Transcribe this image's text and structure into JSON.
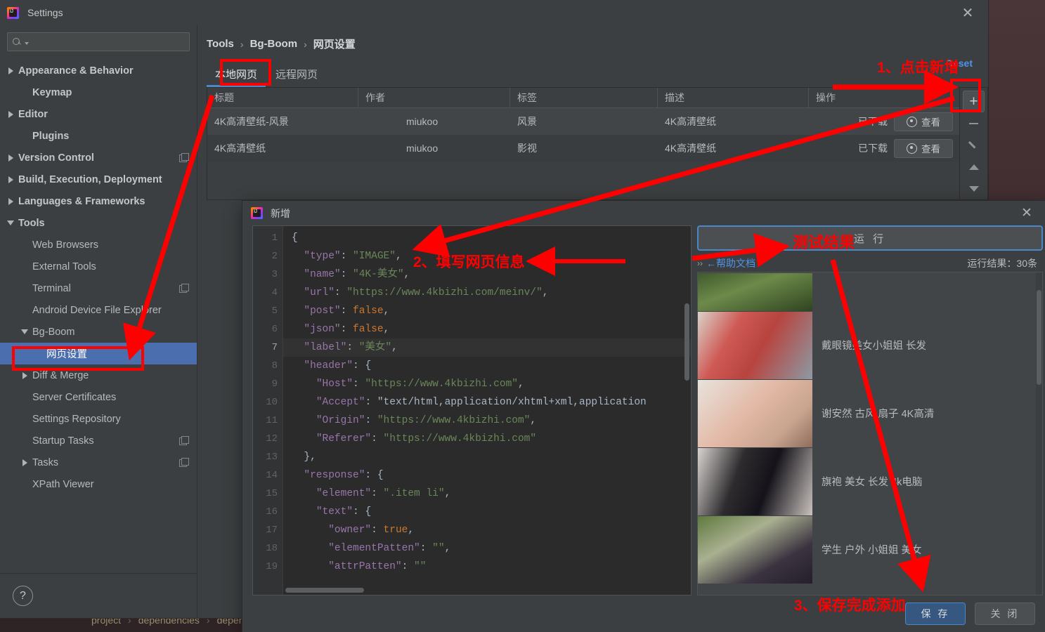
{
  "background_ide": {
    "breadcrumb": [
      "project",
      "dependencies",
      "dependency"
    ],
    "separator": "›"
  },
  "settings_window": {
    "title": "Settings",
    "title_icon": "intellij-idea-icon",
    "close_icon": "close-icon",
    "search": {
      "placeholder": "",
      "value": "",
      "icon": "search-icon"
    },
    "help_icon": "help-question-icon",
    "sidebar": {
      "items": [
        {
          "label": "Appearance & Behavior",
          "arrow": "right",
          "indent": 0,
          "bold": true,
          "selected": false,
          "copy": false
        },
        {
          "label": "Keymap",
          "arrow": "none",
          "indent": 1,
          "bold": true,
          "selected": false,
          "copy": false
        },
        {
          "label": "Editor",
          "arrow": "right",
          "indent": 0,
          "bold": true,
          "selected": false,
          "copy": false
        },
        {
          "label": "Plugins",
          "arrow": "none",
          "indent": 1,
          "bold": true,
          "selected": false,
          "copy": false
        },
        {
          "label": "Version Control",
          "arrow": "right",
          "indent": 0,
          "bold": true,
          "selected": false,
          "copy": true
        },
        {
          "label": "Build, Execution, Deployment",
          "arrow": "right",
          "indent": 0,
          "bold": true,
          "selected": false,
          "copy": false
        },
        {
          "label": "Languages & Frameworks",
          "arrow": "right",
          "indent": 0,
          "bold": true,
          "selected": false,
          "copy": false
        },
        {
          "label": "Tools",
          "arrow": "down",
          "indent": 0,
          "bold": true,
          "selected": false,
          "copy": false
        },
        {
          "label": "Web Browsers",
          "arrow": "none",
          "indent": 1,
          "bold": false,
          "selected": false,
          "copy": false
        },
        {
          "label": "External Tools",
          "arrow": "none",
          "indent": 1,
          "bold": false,
          "selected": false,
          "copy": false
        },
        {
          "label": "Terminal",
          "arrow": "none",
          "indent": 1,
          "bold": false,
          "selected": false,
          "copy": true
        },
        {
          "label": "Android Device File Explorer",
          "arrow": "none",
          "indent": 1,
          "bold": false,
          "selected": false,
          "copy": false
        },
        {
          "label": "Bg-Boom",
          "arrow": "down",
          "indent": 1,
          "bold": false,
          "selected": false,
          "copy": false
        },
        {
          "label": "网页设置",
          "arrow": "none",
          "indent": 2,
          "bold": false,
          "selected": true,
          "copy": false
        },
        {
          "label": "Diff & Merge",
          "arrow": "right",
          "indent": 1,
          "bold": false,
          "selected": false,
          "copy": false
        },
        {
          "label": "Server Certificates",
          "arrow": "none",
          "indent": 1,
          "bold": false,
          "selected": false,
          "copy": false
        },
        {
          "label": "Settings Repository",
          "arrow": "none",
          "indent": 1,
          "bold": false,
          "selected": false,
          "copy": false
        },
        {
          "label": "Startup Tasks",
          "arrow": "none",
          "indent": 1,
          "bold": false,
          "selected": false,
          "copy": true
        },
        {
          "label": "Tasks",
          "arrow": "right",
          "indent": 1,
          "bold": false,
          "selected": false,
          "copy": true
        },
        {
          "label": "XPath Viewer",
          "arrow": "none",
          "indent": 1,
          "bold": false,
          "selected": false,
          "copy": false
        }
      ]
    },
    "breadcrumb": {
      "items": [
        "Tools",
        "Bg-Boom",
        "网页设置"
      ],
      "separator": "›"
    },
    "reset_label": "Reset",
    "tabs": [
      {
        "label": "本地网页",
        "active": true
      },
      {
        "label": "远程网页",
        "active": false
      }
    ],
    "table": {
      "columns": [
        "标题",
        "作者",
        "标签",
        "描述",
        "操作"
      ],
      "rows": [
        {
          "title": "4K高清壁纸-风景",
          "author": "miukoo",
          "label": "风景",
          "desc": "4K高清壁纸",
          "status": "已下载",
          "action": "查看"
        },
        {
          "title": "4K高清壁纸",
          "author": "miukoo",
          "label": "影视",
          "desc": "4K高清壁纸",
          "status": "已下载",
          "action": "查看"
        }
      ]
    },
    "toolbar": [
      {
        "icon": "plus-icon",
        "name": "add-button",
        "active": true
      },
      {
        "icon": "minus-icon",
        "name": "remove-button",
        "active": false
      },
      {
        "icon": "pencil-icon",
        "name": "edit-button",
        "active": false
      },
      {
        "icon": "up-arrow-icon",
        "name": "move-up-button",
        "active": false
      },
      {
        "icon": "down-arrow-icon",
        "name": "move-down-button",
        "active": false
      }
    ]
  },
  "new_dialog": {
    "title": "新增",
    "title_icon": "intellij-idea-icon",
    "close_icon": "close-icon",
    "editor": {
      "lines": [
        {
          "n": 1,
          "highlight": false,
          "text": "{"
        },
        {
          "n": 2,
          "highlight": false,
          "text": "  \"type\": \"IMAGE\","
        },
        {
          "n": 3,
          "highlight": false,
          "text": "  \"name\": \"4K-美女\","
        },
        {
          "n": 4,
          "highlight": false,
          "text": "  \"url\": \"https://www.4kbizhi.com/meinv/\","
        },
        {
          "n": 5,
          "highlight": false,
          "text": "  \"post\": false,"
        },
        {
          "n": 6,
          "highlight": false,
          "text": "  \"json\": false,"
        },
        {
          "n": 7,
          "highlight": true,
          "text": "  \"label\": \"美女\","
        },
        {
          "n": 8,
          "highlight": false,
          "text": "  \"header\": {"
        },
        {
          "n": 9,
          "highlight": false,
          "text": "    \"Host\": \"https://www.4kbizhi.com\","
        },
        {
          "n": 10,
          "highlight": false,
          "text": "    \"Accept\": \"text/html,application/xhtml+xml,application"
        },
        {
          "n": 11,
          "highlight": false,
          "text": "    \"Origin\": \"https://www.4kbizhi.com\","
        },
        {
          "n": 12,
          "highlight": false,
          "text": "    \"Referer\": \"https://www.4kbizhi.com\""
        },
        {
          "n": 13,
          "highlight": false,
          "text": "  },"
        },
        {
          "n": 14,
          "highlight": false,
          "text": "  \"response\": {"
        },
        {
          "n": 15,
          "highlight": false,
          "text": "    \"element\": \".item li\","
        },
        {
          "n": 16,
          "highlight": false,
          "text": "    \"text\": {"
        },
        {
          "n": 17,
          "highlight": false,
          "text": "      \"owner\": true,"
        },
        {
          "n": 18,
          "highlight": false,
          "text": "      \"elementPatten\": \"\","
        },
        {
          "n": 19,
          "highlight": false,
          "text": "      \"attrPatten\": \"\""
        }
      ]
    },
    "run_button_label": "运 行",
    "result_header": {
      "chevron": "››",
      "doc_link": "←帮助文档",
      "count_label": "运行结果：30条"
    },
    "results": [
      {
        "text": ""
      },
      {
        "text": "戴眼镜美女小姐姐 长发"
      },
      {
        "text": "谢安然 古风 扇子 4K高清"
      },
      {
        "text": "旗袍 美女 长发 4k电脑"
      },
      {
        "text": "学生 户外 小姐姐 美女"
      }
    ],
    "footer": {
      "save_label": "保 存",
      "close_label": "关 闭"
    }
  },
  "annotations": {
    "step1": "1、点击新增",
    "step2": "2、填写网页信息",
    "step3": "3、保存完成添加",
    "test_result": "测试结果"
  },
  "colors": {
    "accent_blue": "#4b6eaf",
    "link_blue": "#4e94e8",
    "annotation_red": "#ff0000",
    "panel_bg": "#3c3f41",
    "editor_bg": "#2b2b2b"
  }
}
